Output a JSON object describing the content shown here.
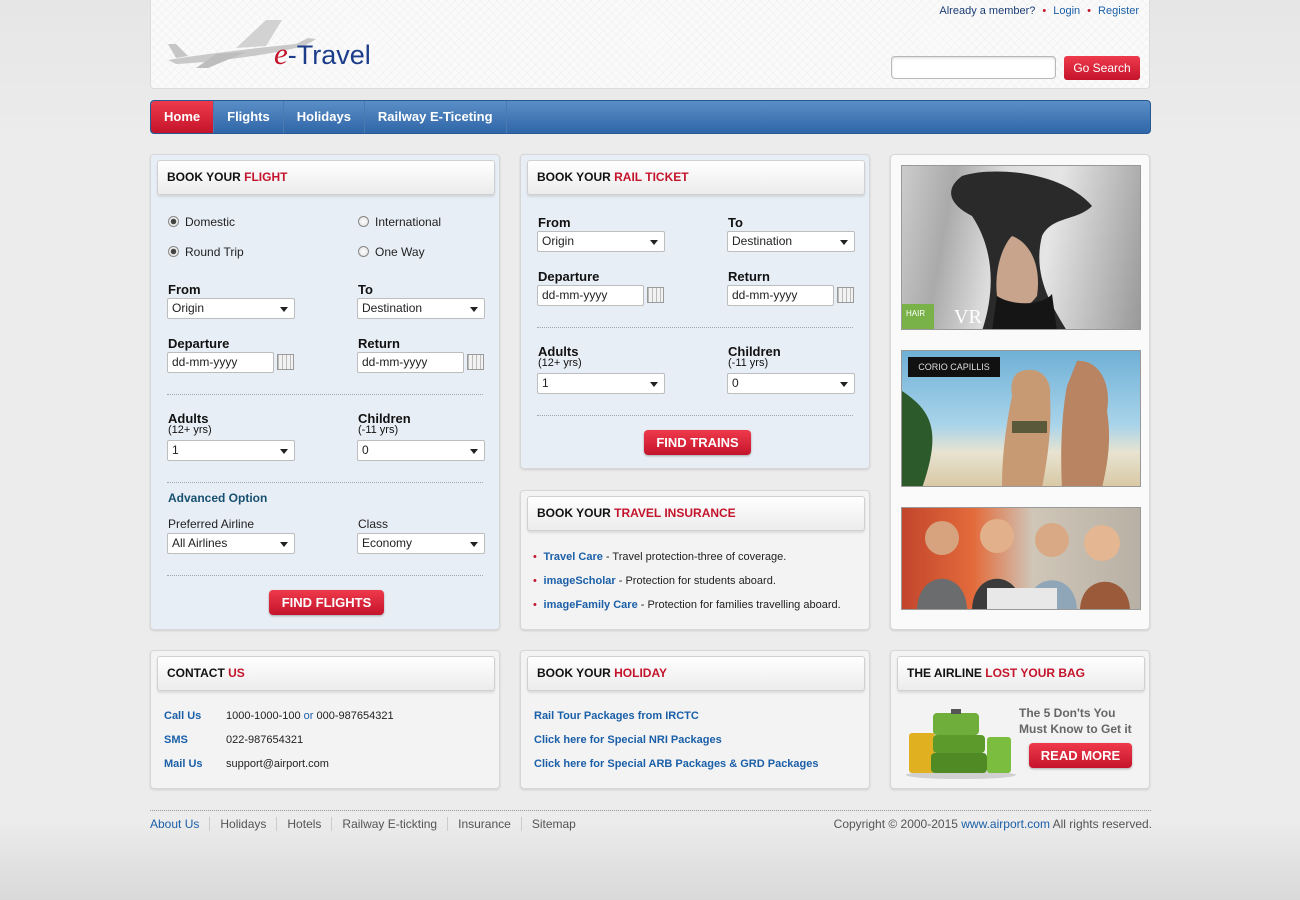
{
  "header": {
    "logo_e": "e",
    "logo_text": "-Travel",
    "already_member": "Already a member?",
    "login": "Login",
    "register": "Register",
    "search_placeholder": "",
    "search_button": "Go Search"
  },
  "nav": {
    "items": [
      {
        "label": "Home",
        "active": true
      },
      {
        "label": "Flights",
        "active": false
      },
      {
        "label": "Holidays",
        "active": false
      },
      {
        "label": "Railway E-Ticeting",
        "active": false
      }
    ]
  },
  "flight": {
    "title_a": "BOOK YOUR ",
    "title_b": "FLIGHT",
    "domestic": "Domestic",
    "international": "International",
    "round_trip": "Round Trip",
    "one_way": "One Way",
    "from_label": "From",
    "from_value": "Origin",
    "to_label": "To",
    "to_value": "Destination",
    "departure_label": "Departure",
    "departure_value": "dd-mm-yyyy",
    "return_label": "Return",
    "return_value": "dd-mm-yyyy",
    "adults_label": "Adults",
    "adults_sub": "(12+ yrs)",
    "adults_value": "1",
    "children_label": "Children",
    "children_sub": "(-11 yrs)",
    "children_value": "0",
    "advanced": "Advanced Option",
    "airline_label": "Preferred Airline",
    "airline_value": "All Airlines",
    "class_label": "Class",
    "class_value": "Economy",
    "button": "FIND FLIGHTS"
  },
  "rail": {
    "title_a": "BOOK YOUR ",
    "title_b": "RAIL TICKET",
    "from_label": "From",
    "from_value": "Origin",
    "to_label": "To",
    "to_value": "Destination",
    "departure_label": "Departure",
    "departure_value": "dd-mm-yyyy",
    "return_label": "Return",
    "return_value": "dd-mm-yyyy",
    "adults_label": "Adults",
    "adults_sub": "(12+ yrs)",
    "adults_value": "1",
    "children_label": "Children",
    "children_sub": "(-11 yrs)",
    "children_value": "0",
    "button": "FIND TRAINS"
  },
  "insurance": {
    "title_a": "BOOK YOUR ",
    "title_b": "TRAVEL INSURANCE",
    "items": [
      {
        "link": "Travel Care",
        "text": " - Travel protection-three of coverage."
      },
      {
        "link": "imageScholar",
        "text": " - Protection for students aboard."
      },
      {
        "link": "imageFamily Care",
        "text": " - Protection for families travelling aboard."
      }
    ]
  },
  "ads": {
    "ad1_brand": "HAIR",
    "ad1_logo": "VR",
    "ad2_brand": "CORIO CAPILLIS"
  },
  "contact": {
    "title_a": "CONTACT ",
    "title_b": "US",
    "call_label": "Call Us",
    "call_value_a": "1000-1000-100",
    "call_or": " or ",
    "call_value_b": "000-987654321",
    "sms_label": "SMS",
    "sms_value": "022-987654321",
    "mail_label": "Mail Us",
    "mail_value": "support@airport.com"
  },
  "holiday": {
    "title_a": "BOOK YOUR ",
    "title_b": "HOLIDAY",
    "links": [
      "Rail Tour Packages from IRCTC",
      "Click here for Special NRI Packages",
      "Click here for Special ARB Packages & GRD Packages"
    ]
  },
  "bag": {
    "title_a": "THE AIRLINE ",
    "title_b": "LOST YOUR BAG",
    "line1": "The 5 Don'ts You",
    "line2": "Must Know to Get it",
    "button": "READ MORE"
  },
  "footer": {
    "links": [
      "About Us",
      "Holidays",
      "Hotels",
      "Railway E-tickting",
      "Insurance",
      "Sitemap"
    ],
    "copyright_a": "Copyright © 2000-2015 ",
    "copyright_link": "www.airport.com",
    "copyright_b": " All rights reserved."
  },
  "colors": {
    "accent_red": "#c4142b",
    "nav_blue": "#2f66a8",
    "link_blue": "#1b5fa8"
  }
}
